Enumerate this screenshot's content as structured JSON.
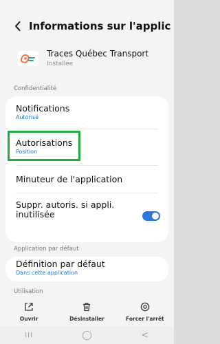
{
  "header": {
    "title": "Informations sur l'applica…"
  },
  "app": {
    "name": "Traces Québec Transport",
    "status": "Installée"
  },
  "sections": {
    "privacy": "Confidentialité",
    "default_app": "Application par défaut",
    "usage": "Utilisation"
  },
  "privacy_items": [
    {
      "title": "Notifications",
      "subtitle": "Autorisé"
    },
    {
      "title": "Autorisations",
      "subtitle": "Position"
    },
    {
      "title": "Minuteur de l'application"
    },
    {
      "title": "Suppr. autoris. si appli. inutilisée",
      "toggle_on": true
    }
  ],
  "default_items": [
    {
      "title": "Définition par défaut",
      "subtitle": "Dans cette application"
    }
  ],
  "bottom_actions": [
    {
      "label": "Ouvrir",
      "icon": "open-icon"
    },
    {
      "label": "Désinstaller",
      "icon": "trash-icon"
    },
    {
      "label": "Forcer l'arrêt",
      "icon": "stop-icon"
    }
  ],
  "colors": {
    "accent": "#1f73d6",
    "toggle": "#2f76dc",
    "highlight": "#23ae3f"
  },
  "nav": {
    "recent": "III",
    "home": "◯",
    "back": "<"
  }
}
